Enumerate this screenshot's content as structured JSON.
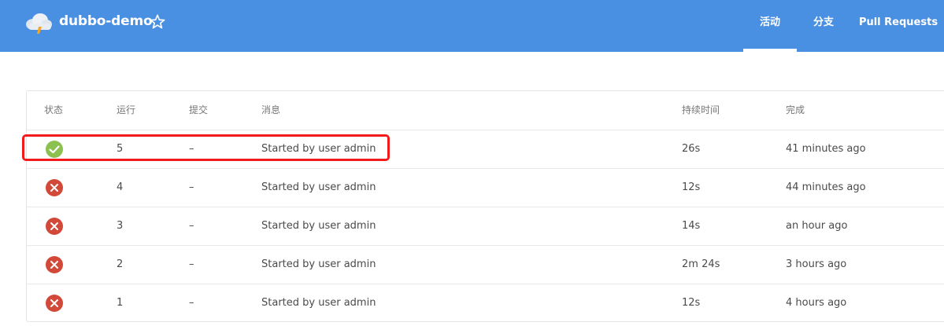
{
  "app": {
    "title": "dubbo-demo",
    "logo_icon": "jenkins-cloud-logo",
    "favorite_icon": "star-outline-icon"
  },
  "tabs": [
    {
      "label": "活动",
      "active": true
    },
    {
      "label": "分支",
      "active": false
    },
    {
      "label": "Pull Requests",
      "active": false
    }
  ],
  "table": {
    "columns": [
      "状态",
      "运行",
      "提交",
      "消息",
      "持续时间",
      "完成"
    ],
    "rows": [
      {
        "status": "success",
        "run": "5",
        "commit": "–",
        "message": "Started by user admin",
        "duration": "26s",
        "completed": "41 minutes ago"
      },
      {
        "status": "failure",
        "run": "4",
        "commit": "–",
        "message": "Started by user admin",
        "duration": "12s",
        "completed": "44 minutes ago"
      },
      {
        "status": "failure",
        "run": "3",
        "commit": "–",
        "message": "Started by user admin",
        "duration": "14s",
        "completed": "an hour ago"
      },
      {
        "status": "failure",
        "run": "2",
        "commit": "–",
        "message": "Started by user admin",
        "duration": "2m 24s",
        "completed": "3 hours ago"
      },
      {
        "status": "failure",
        "run": "1",
        "commit": "–",
        "message": "Started by user admin",
        "duration": "12s",
        "completed": "4 hours ago"
      }
    ]
  },
  "colors": {
    "header_bg": "#4a90e2",
    "success": "#8cc04f",
    "failure": "#d24939",
    "highlight": "#f21b1b"
  }
}
